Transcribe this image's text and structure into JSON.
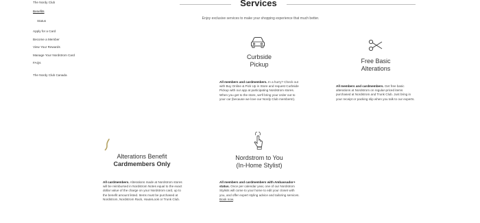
{
  "sidebar": {
    "items": [
      {
        "label": "The Nordy Club"
      },
      {
        "label": "Benefits"
      },
      {
        "label": "Status"
      },
      {
        "label": "Apply for a Card"
      },
      {
        "label": "Become a Member"
      },
      {
        "label": "View Your Rewards"
      },
      {
        "label": "Manage Your Nordstrom Card"
      },
      {
        "label": "FAQs"
      },
      {
        "label": "The Nordy Club Canada"
      }
    ]
  },
  "header": {
    "title": "Services",
    "intro": "Enjoy exclusive services to make your shopping experience that much better."
  },
  "services": [
    {
      "icon": "car-icon",
      "title": "Curbside",
      "title2": "Pickup",
      "lead": "All members and cardmembers.",
      "body": " In a hurry? Check out with Buy Online & Pick Up in Store and request Curbside Pickup with our app at participating Nordstrom stores. When you get to the store, we'll bring your order out to your car (because we love our Nordy Club members!)."
    },
    {
      "icon": "scissors-icon",
      "title": "Free Basic",
      "title2": "Alterations",
      "lead": "All members and cardmembers.",
      "body": " Get free basic alterations at Nordstrom on regular-priced items purchased at Nordstrom and Trunk Club. Just bring in your receipt or packing slip when you talk to our experts."
    },
    {
      "icon": "needle-icon",
      "title": "Alterations Benefit",
      "title2": "Cardmembers Only",
      "lead": "All cardmembers.",
      "body": " Alterations made at Nordstrom stores will be reimbursed in Nordstrom Notes equal to the exact dollar value of the charge on your Nordstrom card, up to the benefit amount listed. Items must be purchased at Nordstrom, Nordstrom Rack, HauteLook or Trunk Club."
    },
    {
      "icon": "hand-pointer-icon",
      "title": "Nordstrom to You",
      "title2": "(In-Home Stylist)",
      "lead": "All members and cardmembers with Ambassador+ status.",
      "body": " Once per calendar year, one of our Nordstrom Stylists will come to your home to edit your closet with you, and offer expert styling advice and tailoring services. ",
      "link": "Book now",
      "tail": "."
    }
  ]
}
